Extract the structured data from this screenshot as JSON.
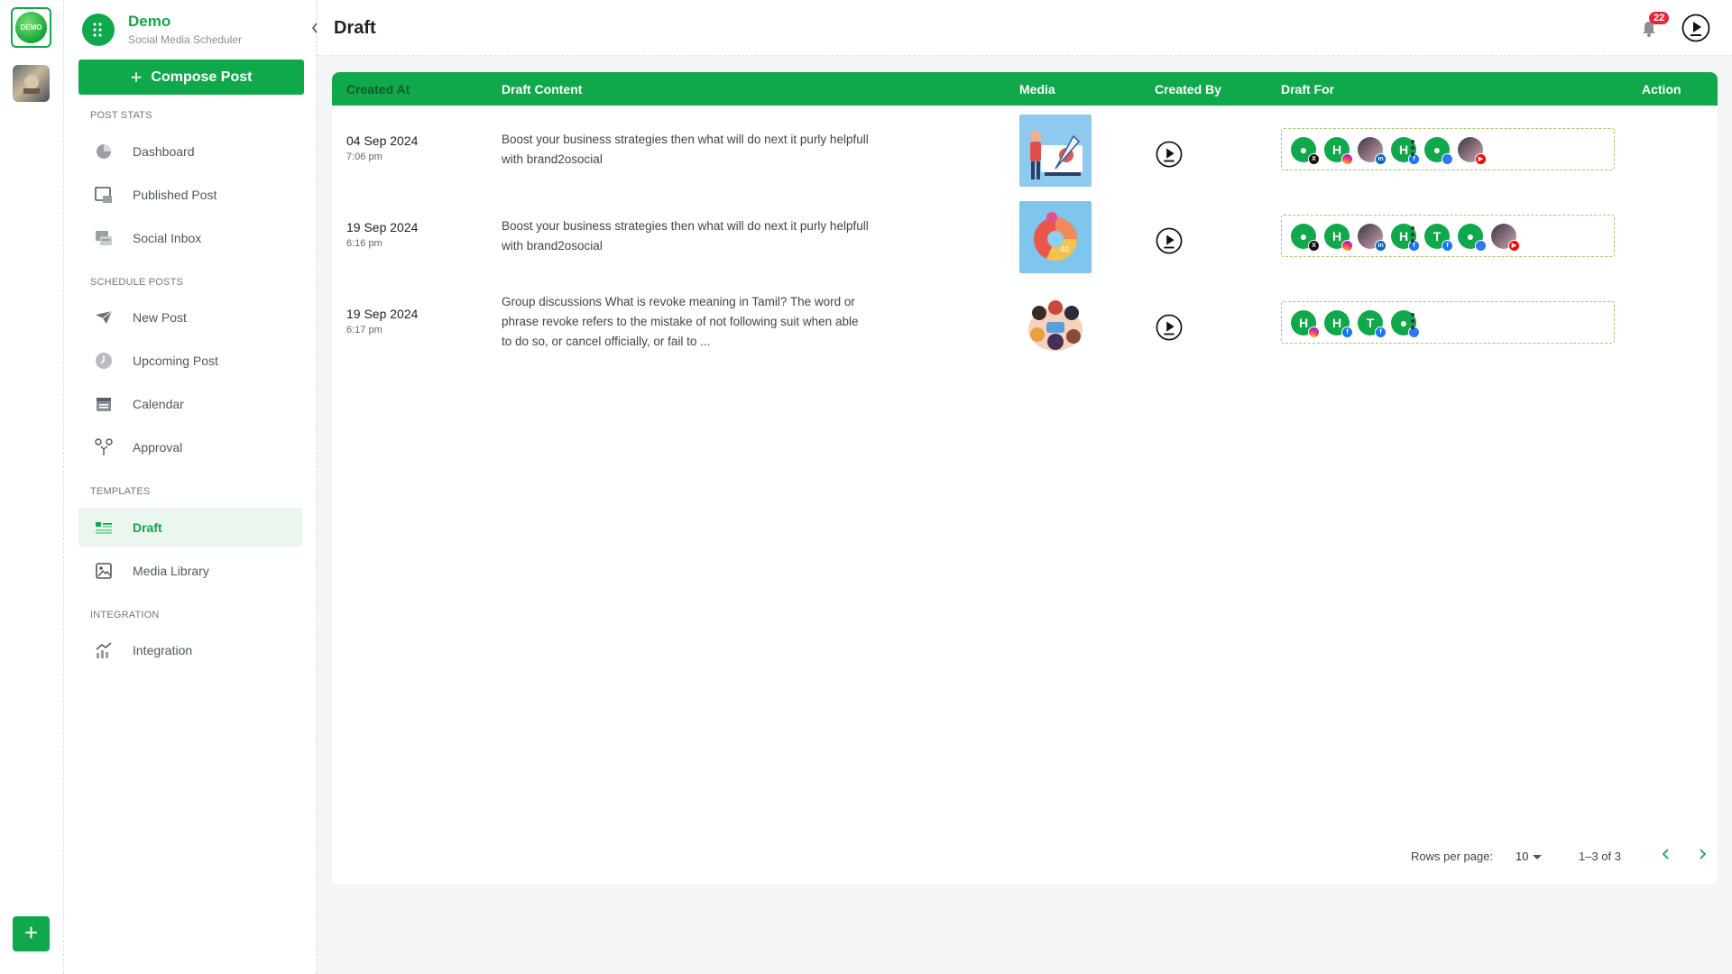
{
  "rail": {
    "workspace_badge": "DEMO",
    "add_label": "+"
  },
  "brand": {
    "name": "Demo",
    "subtitle": "Social Media Scheduler"
  },
  "sidebar": {
    "compose_label": "Compose Post",
    "sections": {
      "post_stats": "POST STATS",
      "schedule_posts": "SCHEDULE POSTS",
      "templates": "TEMPLATES",
      "integration": "INTEGRATION"
    },
    "items": [
      {
        "label": "Dashboard",
        "icon": "dashboard-icon"
      },
      {
        "label": "Published Post",
        "icon": "published-post-icon"
      },
      {
        "label": "Social Inbox",
        "icon": "social-inbox-icon"
      },
      {
        "label": "New Post",
        "icon": "new-post-icon"
      },
      {
        "label": "Upcoming Post",
        "icon": "upcoming-post-icon"
      },
      {
        "label": "Calendar",
        "icon": "calendar-icon"
      },
      {
        "label": "Approval",
        "icon": "approval-icon"
      },
      {
        "label": "Draft",
        "icon": "draft-icon",
        "active": true
      },
      {
        "label": "Media Library",
        "icon": "media-library-icon"
      },
      {
        "label": "Integration",
        "icon": "integration-icon"
      }
    ]
  },
  "header": {
    "title": "Draft",
    "notification_count": "22"
  },
  "table": {
    "columns": [
      "Created At",
      "Draft Content",
      "Media",
      "Created By",
      "Draft For",
      "Action"
    ],
    "rows": [
      {
        "date": "04 Sep 2024",
        "time": "7:06 pm",
        "content": "Boost your business strategies then what will do next it purly helpfull with brand2osocial",
        "media": "business-strategy-illustration",
        "accounts": [
          {
            "avatar": "person",
            "network": "x"
          },
          {
            "avatar": "H",
            "network": "instagram"
          },
          {
            "avatar": "photo",
            "network": "linkedin"
          },
          {
            "avatar": "H",
            "network": "facebook"
          },
          {
            "avatar": "person",
            "network": "google-business"
          },
          {
            "avatar": "photo",
            "network": "youtube"
          }
        ]
      },
      {
        "date": "19 Sep 2024",
        "time": "6:16 pm",
        "content": "Boost your business strategies then what will do next it purly helpfull with brand2osocial",
        "media": "pie-chart-illustration",
        "accounts": [
          {
            "avatar": "person",
            "network": "x"
          },
          {
            "avatar": "H",
            "network": "instagram"
          },
          {
            "avatar": "photo",
            "network": "linkedin"
          },
          {
            "avatar": "H",
            "network": "facebook"
          },
          {
            "avatar": "T",
            "network": "facebook"
          },
          {
            "avatar": "person",
            "network": "google-business"
          },
          {
            "avatar": "photo",
            "network": "youtube"
          }
        ]
      },
      {
        "date": "19 Sep 2024",
        "time": "6:17 pm",
        "content": "Group discussions What is revoke meaning in Tamil? The word or phrase revoke refers to the mistake of not following suit when able to do so, or cancel officially, or fail to ...",
        "media": "group-discussion-illustration",
        "accounts": [
          {
            "avatar": "H",
            "network": "instagram"
          },
          {
            "avatar": "H",
            "network": "facebook"
          },
          {
            "avatar": "T",
            "network": "facebook"
          },
          {
            "avatar": "person",
            "network": "google-business"
          }
        ]
      }
    ]
  },
  "pagination": {
    "rows_per_page_label": "Rows per page:",
    "rows_per_page": "10",
    "range": "1–3 of 3"
  },
  "colors": {
    "brand": "#0fa84a",
    "badge": "#e8283a"
  }
}
